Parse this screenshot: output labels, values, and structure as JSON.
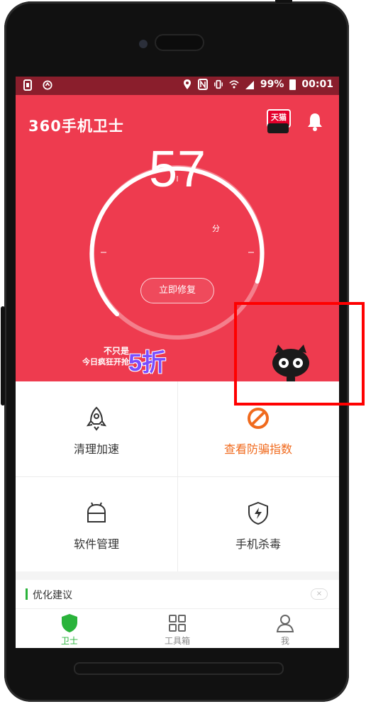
{
  "status_bar": {
    "battery": "99%",
    "time": "00:01"
  },
  "header": {
    "app_title": "360手机卫士",
    "tmall_badge": "天猫",
    "bell_icon": "bell-icon"
  },
  "score": {
    "value": "57",
    "unit": "分",
    "fix_button": "立即修复"
  },
  "promo": {
    "line1": "不只是",
    "line2": "今日疯狂开抢",
    "big": "5折"
  },
  "grid": {
    "items": [
      {
        "label": "清理加速",
        "icon": "rocket-icon"
      },
      {
        "label": "查看防骗指数",
        "icon": "ban-icon",
        "color": "#f06a1d"
      },
      {
        "label": "软件管理",
        "icon": "android-icon"
      },
      {
        "label": "手机杀毒",
        "icon": "shield-bolt-icon"
      }
    ]
  },
  "suggestions": {
    "title": "优化建议",
    "close": "×"
  },
  "nav": {
    "items": [
      {
        "label": "卫士",
        "icon": "shield-icon"
      },
      {
        "label": "工具箱",
        "icon": "grid-icon"
      },
      {
        "label": "我",
        "icon": "person-icon"
      }
    ]
  },
  "colors": {
    "header_red": "#ee3b4f",
    "statusbar": "#8a1e2c",
    "accent_green": "#2ab33b",
    "orange": "#f06a1d",
    "highlight": "#ff0000"
  }
}
